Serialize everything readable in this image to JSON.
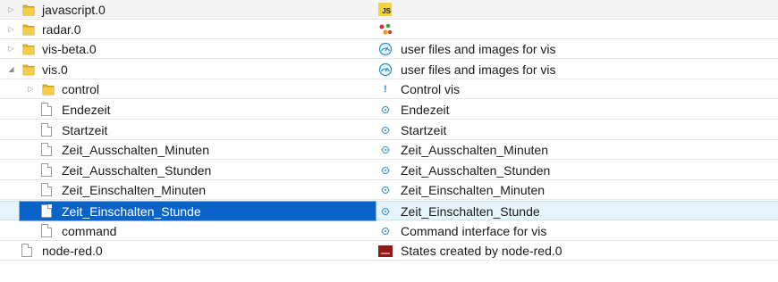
{
  "rows": [
    {
      "name": "javascript.0",
      "desc": "",
      "kind": "folder",
      "expander": "collapsed",
      "icon": "js-icon",
      "depth": 0
    },
    {
      "name": "radar.0",
      "desc": "",
      "kind": "folder",
      "expander": "collapsed",
      "icon": "radar-icon",
      "depth": 0
    },
    {
      "name": "vis-beta.0",
      "desc": "user files and images for vis",
      "kind": "folder",
      "expander": "collapsed",
      "icon": "vis-icon",
      "depth": 0
    },
    {
      "name": "vis.0",
      "desc": "user files and images for vis",
      "kind": "folder",
      "expander": "expanded",
      "icon": "vis-icon",
      "depth": 0
    },
    {
      "name": "control",
      "desc": "Control vis",
      "kind": "folder",
      "expander": "collapsed",
      "icon": "control-icon",
      "depth": 1
    },
    {
      "name": "Endezeit",
      "desc": "Endezeit",
      "kind": "file",
      "expander": "",
      "icon": "state-icon",
      "depth": 1
    },
    {
      "name": "Startzeit",
      "desc": "Startzeit",
      "kind": "file",
      "expander": "",
      "icon": "state-icon",
      "depth": 1
    },
    {
      "name": "Zeit_Ausschalten_Minuten",
      "desc": "Zeit_Ausschalten_Minuten",
      "kind": "file",
      "expander": "",
      "icon": "state-icon",
      "depth": 1
    },
    {
      "name": "Zeit_Ausschalten_Stunden",
      "desc": "Zeit_Ausschalten_Stunden",
      "kind": "file",
      "expander": "",
      "icon": "state-icon",
      "depth": 1
    },
    {
      "name": "Zeit_Einschalten_Minuten",
      "desc": "Zeit_Einschalten_Minuten",
      "kind": "file",
      "expander": "",
      "icon": "state-icon",
      "depth": 1
    },
    {
      "name": "Zeit_Einschalten_Stunde",
      "desc": "Zeit_Einschalten_Stunde",
      "kind": "file",
      "expander": "",
      "icon": "state-icon",
      "depth": 1,
      "selected": true
    },
    {
      "name": "command",
      "desc": "Command interface for vis",
      "kind": "file",
      "expander": "",
      "icon": "state-icon",
      "depth": 1
    },
    {
      "name": "node-red.0",
      "desc": "States created by node-red.0",
      "kind": "file",
      "expander": "",
      "icon": "node-red-icon",
      "depth": 0
    }
  ],
  "colors": {
    "selection": "#0a64c8",
    "selection_row": "#e6f4fb",
    "folder": "#e8b72c",
    "divider": "#e6e6e6"
  },
  "badges": {
    "js": "JS",
    "control": "!"
  }
}
